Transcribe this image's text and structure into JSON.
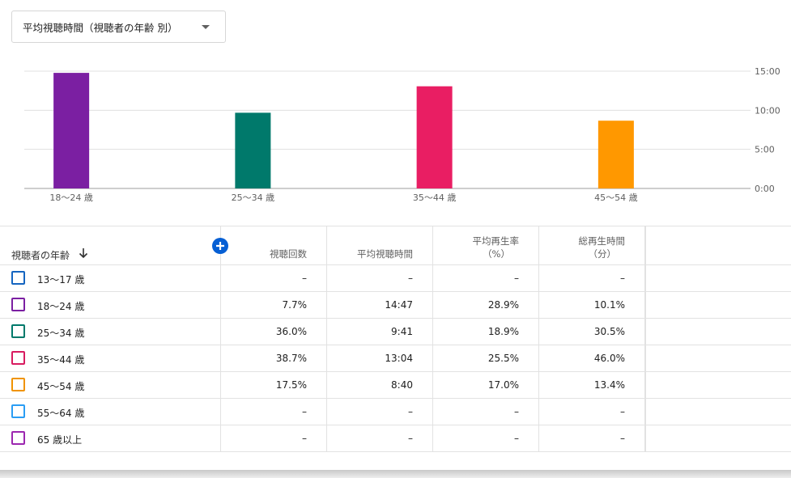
{
  "dropdown": {
    "label": "平均視聴時間（視聴者の年齢 別）",
    "icon": "caret-down-icon"
  },
  "chart_data": {
    "type": "bar",
    "categories": [
      "18〜24 歳",
      "25〜34 歳",
      "35〜44 歳",
      "45〜54 歳"
    ],
    "values_seconds": [
      887,
      581,
      784,
      520
    ],
    "values_label": [
      "14:47",
      "9:41",
      "13:04",
      "8:40"
    ],
    "y_ticks": [
      "15:00",
      "10:00",
      "5:00",
      "0:00"
    ],
    "y_tick_seconds": [
      900,
      600,
      300,
      0
    ],
    "ylim_seconds": [
      0,
      900
    ],
    "colors": [
      "#7b1fa2",
      "#00796b",
      "#e91e63",
      "#ff9800"
    ],
    "grid": true,
    "y_axis_side": "right"
  },
  "table": {
    "first_header": "視聴者の年齢",
    "sort_icon": "arrow-down-icon",
    "add_icon": "add-circle-icon",
    "columns": [
      {
        "line1": "視聴回数",
        "line2": ""
      },
      {
        "line1": "平均視聴時間",
        "line2": ""
      },
      {
        "line1": "平均再生率",
        "line2": "（%）"
      },
      {
        "line1": "総再生時間",
        "line2": "（分）"
      }
    ],
    "rows": [
      {
        "age": "13〜17 歳",
        "color": "#1565c0",
        "views": "–",
        "avg": "–",
        "rate": "–",
        "total": "–"
      },
      {
        "age": "18〜24 歳",
        "color": "#7b1fa2",
        "views": "7.7%",
        "avg": "14:47",
        "rate": "28.9%",
        "total": "10.1%"
      },
      {
        "age": "25〜34 歳",
        "color": "#00796b",
        "views": "36.0%",
        "avg": "9:41",
        "rate": "18.9%",
        "total": "30.5%"
      },
      {
        "age": "35〜44 歳",
        "color": "#d81b60",
        "views": "38.7%",
        "avg": "13:04",
        "rate": "25.5%",
        "total": "46.0%"
      },
      {
        "age": "45〜54 歳",
        "color": "#f09300",
        "views": "17.5%",
        "avg": "8:40",
        "rate": "17.0%",
        "total": "13.4%"
      },
      {
        "age": "55〜64 歳",
        "color": "#2a9df4",
        "views": "–",
        "avg": "–",
        "rate": "–",
        "total": "–"
      },
      {
        "age": "65 歳以上",
        "color": "#9c27b0",
        "views": "–",
        "avg": "–",
        "rate": "–",
        "total": "–"
      }
    ]
  }
}
